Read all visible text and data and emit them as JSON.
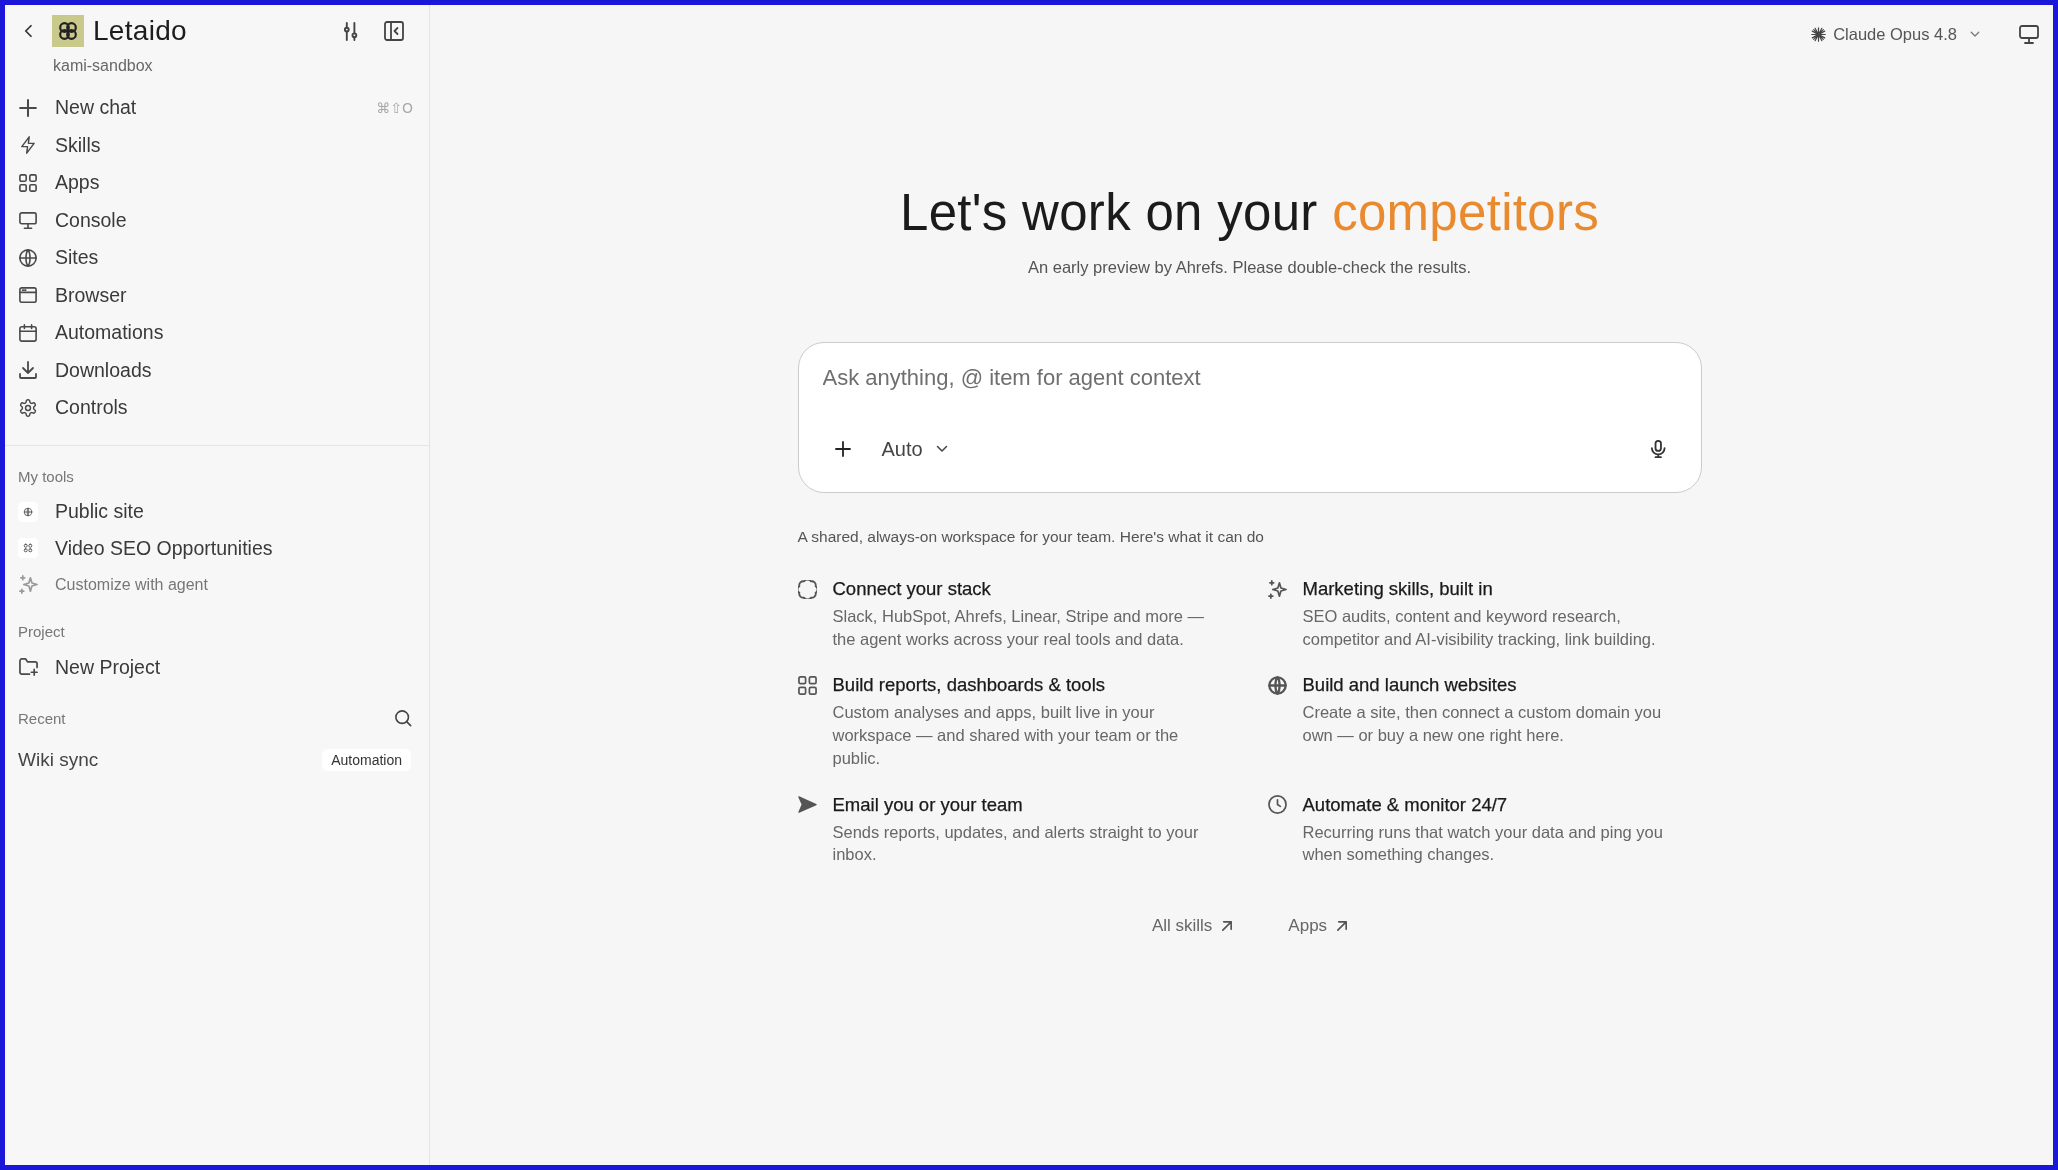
{
  "sidebar": {
    "brand": "Letaido",
    "workspace": "kami-sandbox",
    "nav": [
      {
        "label": "New chat",
        "shortcut": "⌘⇧O"
      },
      {
        "label": "Skills"
      },
      {
        "label": "Apps"
      },
      {
        "label": "Console"
      },
      {
        "label": "Sites"
      },
      {
        "label": "Browser"
      },
      {
        "label": "Automations"
      },
      {
        "label": "Downloads"
      },
      {
        "label": "Controls"
      }
    ],
    "my_tools": {
      "heading": "My tools",
      "items": [
        {
          "label": "Public site"
        },
        {
          "label": "Video SEO Opportunities"
        }
      ],
      "customize": "Customize with agent"
    },
    "project": {
      "heading": "Project",
      "items": [
        {
          "label": "New Project"
        }
      ]
    },
    "recent": {
      "heading": "Recent",
      "items": [
        {
          "title": "Wiki sync",
          "tag": "Automation"
        }
      ]
    }
  },
  "topbar": {
    "model": "Claude Opus 4.8"
  },
  "hero": {
    "title": "Let's work on your",
    "highlight": "competitors",
    "subtitle": "An early preview by Ahrefs. Please double-check the results."
  },
  "composer": {
    "placeholder": "Ask anything, @ item for agent context",
    "mode": "Auto"
  },
  "capabilities": {
    "intro": "A shared, always-on workspace for your team. Here's what it can do",
    "items": [
      {
        "title": "Connect your stack",
        "description": "Slack, HubSpot, Ahrefs, Linear, Stripe and more — the agent works across your real tools and data."
      },
      {
        "title": "Marketing skills, built in",
        "description": "SEO audits, content and keyword research, competitor and AI-visibility tracking, link building."
      },
      {
        "title": "Build reports, dashboards & tools",
        "description": "Custom analyses and apps, built live in your workspace — and shared with your team or the public."
      },
      {
        "title": "Build and launch websites",
        "description": "Create a site, then connect a custom domain you own — or buy a new one right here."
      },
      {
        "title": "Email you or your team",
        "description": "Sends reports, updates, and alerts straight to your inbox."
      },
      {
        "title": "Automate & monitor 24/7",
        "description": "Recurring runs that watch your data and ping you when something changes."
      }
    ]
  },
  "links": [
    {
      "label": "All skills"
    },
    {
      "label": "Apps"
    }
  ]
}
